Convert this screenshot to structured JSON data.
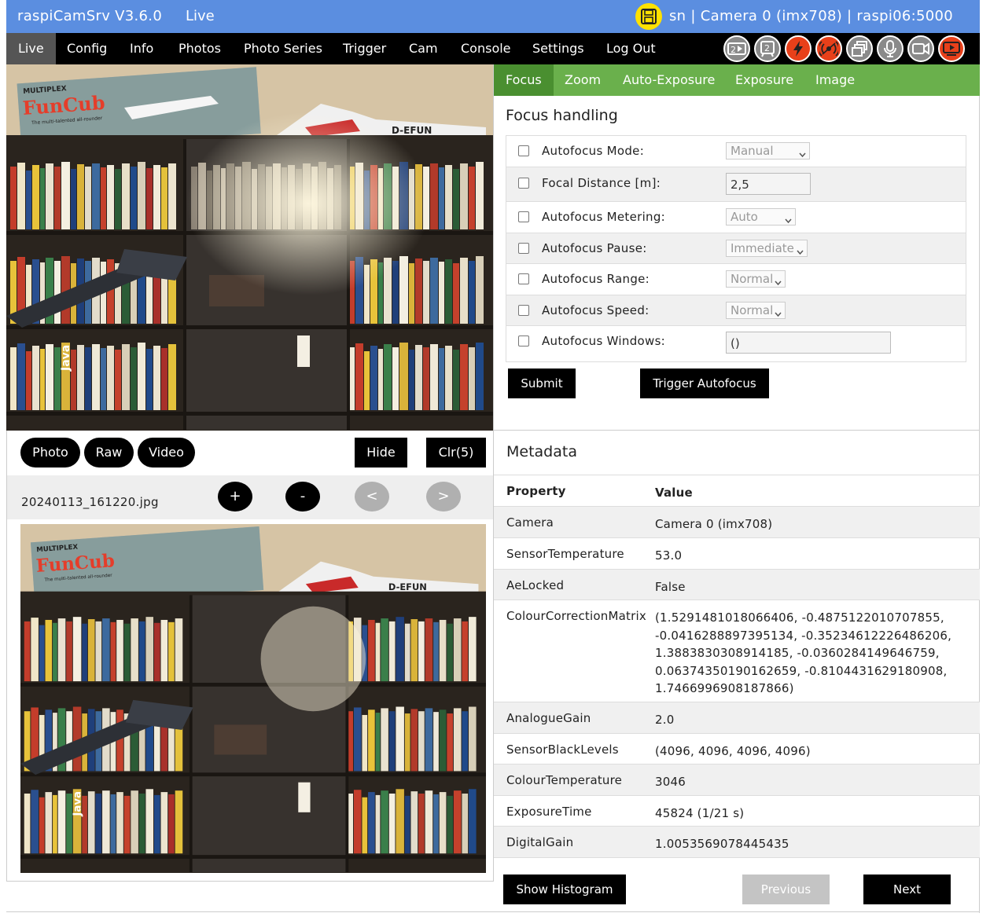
{
  "header": {
    "app_title": "raspiCamSrv V3.6.0",
    "mode": "Live",
    "camera_info": "sn | Camera 0 (imx708) | raspi06:5000",
    "save_icon": "floppy-disk-icon",
    "accent_color": "#5b8ee0"
  },
  "nav": {
    "items": [
      "Live",
      "Config",
      "Info",
      "Photos",
      "Photo Series",
      "Trigger",
      "Cam",
      "Console",
      "Settings",
      "Log Out"
    ],
    "active": "Live",
    "toolbar_icons": [
      "2-camera-icon",
      "camera-2-icon",
      "lightning-icon",
      "alarm-icon",
      "windows-icon",
      "microphone-icon",
      "video-camera-icon",
      "stream-icon"
    ]
  },
  "control_tabs": {
    "items": [
      "Focus",
      "Zoom",
      "Auto-Exposure",
      "Exposure",
      "Image"
    ],
    "active": "Focus",
    "color": "#6ab04c"
  },
  "focus": {
    "title": "Focus handling",
    "rows": [
      {
        "label": "Autofocus Mode:",
        "value": "Manual",
        "kind": "select"
      },
      {
        "label": "Focal Distance [m]:",
        "value": "2,5",
        "kind": "input"
      },
      {
        "label": "Autofocus Metering:",
        "value": "Auto",
        "kind": "select"
      },
      {
        "label": "Autofocus Pause:",
        "value": "Immediate",
        "kind": "select"
      },
      {
        "label": "Autofocus Range:",
        "value": "Normal",
        "kind": "select"
      },
      {
        "label": "Autofocus Speed:",
        "value": "Normal",
        "kind": "select"
      },
      {
        "label": "Autofocus Windows:",
        "value": "()",
        "kind": "input"
      }
    ],
    "submit_label": "Submit",
    "trigger_label": "Trigger Autofocus"
  },
  "photo": {
    "buttons": {
      "photo": "Photo",
      "raw": "Raw",
      "video": "Video",
      "hide": "Hide",
      "clear": "Clr(5)"
    },
    "filename": "20240113_161220.jpg",
    "nav": {
      "plus": "+",
      "minus": "-",
      "prev": "<",
      "next": ">"
    }
  },
  "metadata": {
    "title": "Metadata",
    "header": {
      "property": "Property",
      "value": "Value"
    },
    "rows": [
      {
        "property": "Camera",
        "value": "Camera 0 (imx708)"
      },
      {
        "property": "SensorTemperature",
        "value": "53.0"
      },
      {
        "property": "AeLocked",
        "value": "False"
      },
      {
        "property": "ColourCorrectionMatrix",
        "value": "(1.5291481018066406, -0.4875122010707855, -0.0416288897395134, -0.35234612226486206, 1.3883830308914185, -0.0360284149646759, 0.06374350190162659, -0.8104431629180908, 1.7466996908187866)"
      },
      {
        "property": "AnalogueGain",
        "value": "2.0"
      },
      {
        "property": "SensorBlackLevels",
        "value": "(4096, 4096, 4096, 4096)"
      },
      {
        "property": "ColourTemperature",
        "value": "3046"
      },
      {
        "property": "ExposureTime",
        "value": "45824 (1/21 s)"
      },
      {
        "property": "DigitalGain",
        "value": "1.0053569078445435"
      }
    ],
    "histogram_label": "Show Histogram",
    "previous_label": "Previous",
    "next_label": "Next"
  },
  "scene_text": {
    "brand": "MULTIPLEX",
    "product": "FunCub",
    "tagline": "The multi-talented all-rounder",
    "registration": "D-EFUN",
    "book_title": "Java"
  }
}
